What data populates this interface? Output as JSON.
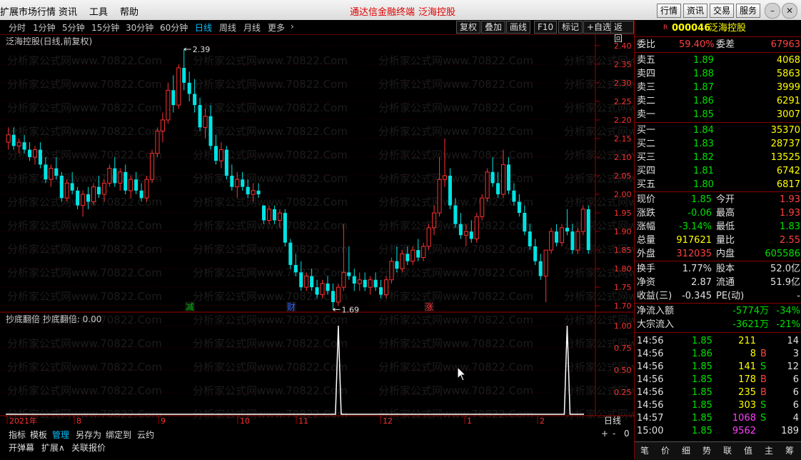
{
  "menubar": {
    "items": [
      "扩展市场行情",
      "资讯",
      "工具",
      "帮助"
    ],
    "center_title": "通达信金融终端",
    "stock_title": "泛海控股",
    "right_buttons": [
      "行情",
      "资讯",
      "交易",
      "服务"
    ]
  },
  "periods": [
    "分时",
    "1分钟",
    "5分钟",
    "15分钟",
    "30分钟",
    "60分钟",
    "日线",
    "周线",
    "月线",
    "更多"
  ],
  "active_period": "日线",
  "chart_tools": [
    "复权",
    "叠加",
    "画线",
    "F10",
    "标记",
    "+自选",
    "返回"
  ],
  "chart_title": "泛海控股(日线,前复权)",
  "indicator_title": "抄底翻倍  抄底翻倍: 0.00",
  "price_axis": [
    "2.40",
    "2.35",
    "2.30",
    "2.25",
    "2.20",
    "2.15",
    "2.10",
    "2.05",
    "2.00",
    "1.95",
    "1.90",
    "1.85",
    "1.80",
    "1.75",
    "1.70"
  ],
  "indicator_axis": [
    "1.00",
    "0.75",
    "0.50",
    "0.25"
  ],
  "high_label": "2.39",
  "low_label": "1.69",
  "event_marks": [
    "减",
    "财",
    "涨"
  ],
  "date_axis": [
    "2021年",
    "8",
    "9",
    "10",
    "11",
    "12",
    "1",
    "2"
  ],
  "period_label": "日线",
  "watermark": "分析家公式网www.70822.Com",
  "bottom_tabs": [
    "指标",
    "模板",
    "管理",
    "另存为",
    "绑定到",
    "云约"
  ],
  "bottom_tabs2": [
    "开弹幕",
    "扩展∧",
    "关联报价"
  ],
  "zoom_buttons": [
    "+",
    "-",
    "0"
  ],
  "quote": {
    "code": "000046",
    "name": "泛海控股",
    "weibi_label": "委比",
    "weibi": "59.40%",
    "weicha_label": "委差",
    "weicha": "67963",
    "asks": [
      {
        "label": "卖五",
        "price": "1.89",
        "vol": "4068"
      },
      {
        "label": "卖四",
        "price": "1.88",
        "vol": "5863"
      },
      {
        "label": "卖三",
        "price": "1.87",
        "vol": "3999"
      },
      {
        "label": "卖二",
        "price": "1.86",
        "vol": "6291"
      },
      {
        "label": "卖一",
        "price": "1.85",
        "vol": "3007"
      }
    ],
    "bids": [
      {
        "label": "买一",
        "price": "1.84",
        "vol": "35370"
      },
      {
        "label": "买二",
        "price": "1.83",
        "vol": "28737"
      },
      {
        "label": "买三",
        "price": "1.82",
        "vol": "13525"
      },
      {
        "label": "买四",
        "price": "1.81",
        "vol": "6742"
      },
      {
        "label": "买五",
        "price": "1.80",
        "vol": "6817"
      }
    ],
    "stats": [
      {
        "l1": "现价",
        "v1": "1.85",
        "c1": "green",
        "l2": "今开",
        "v2": "1.93",
        "c2": "red"
      },
      {
        "l1": "涨跌",
        "v1": "-0.06",
        "c1": "green",
        "l2": "最高",
        "v2": "1.93",
        "c2": "red"
      },
      {
        "l1": "涨幅",
        "v1": "-3.14%",
        "c1": "green",
        "l2": "最低",
        "v2": "1.83",
        "c2": "green"
      },
      {
        "l1": "总量",
        "v1": "917621",
        "c1": "yellow",
        "l2": "量比",
        "v2": "2.55",
        "c2": "red"
      },
      {
        "l1": "外盘",
        "v1": "312035",
        "c1": "red",
        "l2": "内盘",
        "v2": "605586",
        "c2": "green"
      }
    ],
    "stats2": [
      {
        "l1": "换手",
        "v1": "1.77%",
        "l2": "股本",
        "v2": "52.0亿"
      },
      {
        "l1": "净资",
        "v1": "2.87",
        "l2": "流通",
        "v2": "51.9亿"
      },
      {
        "l1": "收益(三)",
        "v1": "-0.345",
        "l2": "PE(动)",
        "v2": "-"
      }
    ],
    "flows": [
      {
        "label": "净流入额",
        "value": "-5774万",
        "pct": "-34%"
      },
      {
        "label": "大宗流入",
        "value": "-3621万",
        "pct": "-21%"
      }
    ],
    "ticks": [
      {
        "time": "14:56",
        "price": "1.85",
        "vol": "211",
        "side": "",
        "n": "14"
      },
      {
        "time": "14:56",
        "price": "1.86",
        "vol": "8",
        "side": "B",
        "n": "3"
      },
      {
        "time": "14:56",
        "price": "1.85",
        "vol": "141",
        "side": "S",
        "n": "12"
      },
      {
        "time": "14:56",
        "price": "1.85",
        "vol": "178",
        "side": "B",
        "n": "6"
      },
      {
        "time": "14:56",
        "price": "1.85",
        "vol": "235",
        "side": "B",
        "n": "6"
      },
      {
        "time": "14:56",
        "price": "1.85",
        "vol": "303",
        "side": "S",
        "n": "6"
      },
      {
        "time": "14:57",
        "price": "1.85",
        "vol": "1068",
        "side": "S",
        "n": "4"
      },
      {
        "time": "15:00",
        "price": "1.85",
        "vol": "9562",
        "side": "",
        "n": "189"
      }
    ],
    "panel_tabs": [
      "笔",
      "价",
      "细",
      "势",
      "联",
      "值",
      "主",
      "筹"
    ]
  },
  "candles": [
    [
      2.14,
      2.18,
      2.12,
      2.16
    ],
    [
      2.16,
      2.18,
      2.12,
      2.13
    ],
    [
      2.13,
      2.15,
      2.11,
      2.14
    ],
    [
      2.14,
      2.16,
      2.11,
      2.12
    ],
    [
      2.12,
      2.14,
      2.09,
      2.1
    ],
    [
      2.1,
      2.13,
      2.08,
      2.12
    ],
    [
      2.12,
      2.14,
      2.07,
      2.08
    ],
    [
      2.08,
      2.1,
      2.03,
      2.04
    ],
    [
      2.04,
      2.08,
      2.02,
      2.07
    ],
    [
      2.07,
      2.1,
      2.04,
      2.05
    ],
    [
      2.05,
      2.06,
      1.98,
      1.99
    ],
    [
      1.99,
      2.04,
      1.98,
      2.03
    ],
    [
      2.03,
      2.06,
      2.0,
      2.01
    ],
    [
      2.01,
      2.02,
      1.96,
      1.97
    ],
    [
      1.97,
      2.01,
      1.94,
      2.0
    ],
    [
      2.0,
      2.02,
      1.96,
      1.98
    ],
    [
      1.98,
      2.03,
      1.97,
      2.02
    ],
    [
      2.02,
      2.05,
      1.99,
      2.0
    ],
    [
      2.0,
      2.04,
      1.98,
      2.03
    ],
    [
      2.03,
      2.08,
      2.02,
      2.07
    ],
    [
      2.07,
      2.1,
      2.02,
      2.03
    ],
    [
      2.03,
      2.07,
      2.01,
      2.06
    ],
    [
      2.06,
      2.08,
      2.0,
      2.01
    ],
    [
      2.01,
      2.05,
      1.99,
      2.04
    ],
    [
      2.04,
      2.06,
      2.0,
      2.01
    ],
    [
      2.01,
      2.03,
      1.98,
      1.99
    ],
    [
      1.99,
      2.05,
      1.98,
      2.04
    ],
    [
      2.04,
      2.12,
      2.03,
      2.11
    ],
    [
      2.11,
      2.18,
      2.1,
      2.17
    ],
    [
      2.17,
      2.22,
      2.14,
      2.2
    ],
    [
      2.2,
      2.3,
      2.19,
      2.28
    ],
    [
      2.28,
      2.32,
      2.22,
      2.24
    ],
    [
      2.24,
      2.35,
      2.23,
      2.34
    ],
    [
      2.34,
      2.39,
      2.28,
      2.3
    ],
    [
      2.3,
      2.33,
      2.25,
      2.27
    ],
    [
      2.27,
      2.31,
      2.22,
      2.24
    ],
    [
      2.24,
      2.26,
      2.17,
      2.18
    ],
    [
      2.18,
      2.23,
      2.15,
      2.21
    ],
    [
      2.21,
      2.24,
      2.12,
      2.13
    ],
    [
      2.13,
      2.16,
      2.08,
      2.09
    ],
    [
      2.09,
      2.14,
      2.07,
      2.12
    ],
    [
      2.12,
      2.13,
      2.04,
      2.05
    ],
    [
      2.05,
      2.08,
      2.01,
      2.02
    ],
    [
      2.02,
      2.06,
      1.99,
      2.04
    ],
    [
      2.04,
      2.06,
      2.01,
      2.02
    ],
    [
      2.02,
      2.04,
      1.99,
      2.0
    ],
    [
      2.0,
      2.03,
      1.98,
      2.01
    ],
    [
      2.01,
      2.03,
      1.99,
      2.0
    ],
    [
      1.97,
      1.97,
      1.92,
      1.93
    ],
    [
      1.93,
      1.97,
      1.92,
      1.96
    ],
    [
      1.96,
      1.97,
      1.92,
      1.93
    ],
    [
      1.93,
      1.96,
      1.91,
      1.95
    ],
    [
      1.95,
      1.96,
      1.86,
      1.87
    ],
    [
      1.87,
      1.88,
      1.8,
      1.81
    ],
    [
      1.81,
      1.84,
      1.78,
      1.79
    ],
    [
      1.79,
      1.82,
      1.74,
      1.75
    ],
    [
      1.75,
      1.79,
      1.74,
      1.78
    ],
    [
      1.78,
      1.8,
      1.74,
      1.75
    ],
    [
      1.75,
      1.77,
      1.72,
      1.73
    ],
    [
      1.73,
      1.77,
      1.72,
      1.76
    ],
    [
      1.76,
      1.78,
      1.73,
      1.74
    ],
    [
      1.74,
      1.76,
      1.69,
      1.71
    ],
    [
      1.71,
      1.76,
      1.7,
      1.75
    ],
    [
      1.75,
      1.92,
      1.74,
      1.79
    ],
    [
      1.79,
      1.86,
      1.77,
      1.78
    ],
    [
      1.78,
      1.8,
      1.74,
      1.76
    ],
    [
      1.76,
      1.79,
      1.74,
      1.77
    ],
    [
      1.77,
      1.79,
      1.74,
      1.75
    ],
    [
      1.75,
      1.78,
      1.73,
      1.77
    ],
    [
      1.77,
      1.79,
      1.74,
      1.75
    ],
    [
      1.75,
      1.77,
      1.72,
      1.73
    ],
    [
      1.73,
      1.78,
      1.72,
      1.77
    ],
    [
      1.77,
      1.83,
      1.76,
      1.82
    ],
    [
      1.82,
      1.86,
      1.79,
      1.8
    ],
    [
      1.8,
      1.85,
      1.79,
      1.84
    ],
    [
      1.84,
      1.86,
      1.81,
      1.82
    ],
    [
      1.82,
      1.86,
      1.81,
      1.85
    ],
    [
      1.85,
      1.88,
      1.82,
      1.83
    ],
    [
      1.83,
      1.87,
      1.82,
      1.86
    ],
    [
      1.86,
      1.92,
      1.85,
      1.91
    ],
    [
      1.91,
      1.97,
      1.89,
      1.95
    ],
    [
      1.95,
      2.1,
      1.94,
      2.04
    ],
    [
      2.04,
      2.15,
      2.02,
      2.05
    ],
    [
      2.05,
      2.07,
      1.96,
      1.97
    ],
    [
      1.97,
      1.99,
      1.91,
      1.92
    ],
    [
      1.92,
      1.95,
      1.88,
      1.89
    ],
    [
      1.89,
      1.92,
      1.86,
      1.9
    ],
    [
      1.9,
      1.93,
      1.87,
      1.88
    ],
    [
      1.88,
      1.95,
      1.87,
      1.94
    ],
    [
      1.94,
      2.0,
      1.93,
      1.99
    ],
    [
      1.99,
      2.07,
      1.98,
      2.06
    ],
    [
      2.06,
      2.1,
      2.02,
      2.03
    ],
    [
      2.03,
      2.06,
      1.99,
      2.0
    ],
    [
      2.0,
      2.12,
      1.99,
      2.08
    ],
    [
      2.08,
      2.1,
      2.0,
      2.01
    ],
    [
      2.01,
      2.03,
      1.97,
      1.98
    ],
    [
      1.98,
      2.0,
      1.94,
      1.95
    ],
    [
      1.95,
      1.97,
      1.89,
      1.9
    ],
    [
      1.9,
      1.92,
      1.85,
      1.86
    ],
    [
      1.86,
      1.88,
      1.81,
      1.82
    ],
    [
      1.82,
      1.84,
      1.77,
      1.78
    ],
    [
      1.78,
      1.81,
      1.71,
      1.85
    ],
    [
      1.85,
      1.91,
      1.84,
      1.9
    ],
    [
      1.9,
      1.92,
      1.86,
      1.87
    ],
    [
      1.87,
      1.92,
      1.86,
      1.91
    ],
    [
      1.91,
      1.96,
      1.89,
      1.9
    ],
    [
      1.9,
      1.92,
      1.84,
      1.85
    ],
    [
      1.85,
      1.91,
      1.84,
      1.9
    ],
    [
      1.9,
      1.97,
      1.89,
      1.96
    ],
    [
      1.96,
      1.97,
      1.84,
      1.85
    ]
  ],
  "indicator_spikes": [
    62,
    105
  ]
}
